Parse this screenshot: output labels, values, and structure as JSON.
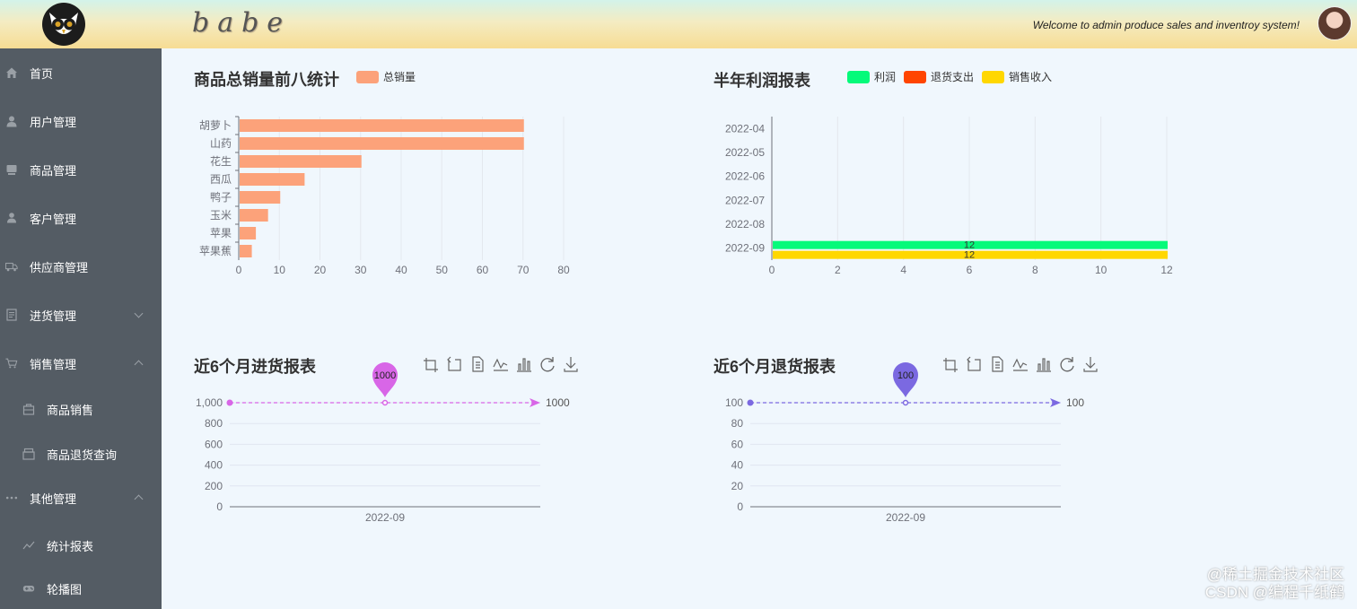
{
  "header": {
    "brand": "babe",
    "welcome": "Welcome to admin produce sales and inventroy system!"
  },
  "sidebar": {
    "items": [
      {
        "label": "首页",
        "icon": "home-icon"
      },
      {
        "label": "用户管理",
        "icon": "user-icon"
      },
      {
        "label": "商品管理",
        "icon": "goods-icon"
      },
      {
        "label": "客户管理",
        "icon": "customer-icon"
      },
      {
        "label": "供应商管理",
        "icon": "truck-icon"
      },
      {
        "label": "进货管理",
        "icon": "document-icon"
      },
      {
        "label": "销售管理",
        "icon": "cart-icon"
      },
      {
        "label": "商品销售",
        "icon": "bag-icon"
      },
      {
        "label": "商品退货查询",
        "icon": "box-icon"
      },
      {
        "label": "其他管理",
        "icon": "more-icon"
      },
      {
        "label": "统计报表",
        "icon": "trend-icon"
      },
      {
        "label": "轮播图",
        "icon": "gamepad-icon"
      }
    ]
  },
  "colors": {
    "sidebar_bg": "#545c64",
    "bar_orange": "#fca27a",
    "profit_green": "#05fa7a",
    "return_red": "#ff4500",
    "sales_yellow": "#ffd700",
    "purchase_purple": "#d866e7",
    "return_purple": "#7b69e1"
  },
  "charts": {
    "top8": {
      "title": "商品总销量前八统计",
      "legend": "总销量"
    },
    "profit": {
      "title": "半年利润报表",
      "legend": [
        "利润",
        "退货支出",
        "销售收入"
      ]
    },
    "purchase": {
      "title": "近6个月进货报表",
      "pin_label": "1000",
      "end_label": "1000"
    },
    "returns": {
      "title": "近6个月退货报表",
      "pin_label": "100",
      "end_label": "100"
    }
  },
  "toolbox_icons": [
    "zoom-icon",
    "zoom-reset-icon",
    "data-view-icon",
    "line-icon",
    "bar-icon",
    "restore-icon",
    "save-icon"
  ],
  "watermark": {
    "line1": "@稀土掘金技术社区",
    "line2": "CSDN @编程千纸鹤"
  },
  "chart_data": [
    {
      "type": "bar",
      "orientation": "horizontal",
      "title": "商品总销量前八统计",
      "categories": [
        "胡萝卜",
        "山药",
        "花生",
        "西瓜",
        "鸭子",
        "玉米",
        "苹果",
        "苹果蕉"
      ],
      "series": [
        {
          "name": "总销量",
          "values": [
            70,
            70,
            30,
            16,
            10,
            7,
            4,
            3
          ]
        }
      ],
      "xlim": [
        0,
        80
      ],
      "xticks": [
        "0",
        "10",
        "20",
        "30",
        "40",
        "50",
        "60",
        "70",
        "80"
      ],
      "grid": true,
      "legend": "top"
    },
    {
      "type": "bar",
      "orientation": "horizontal",
      "title": "半年利润报表",
      "categories": [
        "2022-04",
        "2022-05",
        "2022-06",
        "2022-07",
        "2022-08",
        "2022-09"
      ],
      "series": [
        {
          "name": "利润",
          "values": [
            0,
            0,
            0,
            0,
            0,
            12
          ]
        },
        {
          "name": "退货支出",
          "values": [
            0,
            0,
            0,
            0,
            0,
            0
          ]
        },
        {
          "name": "销售收入",
          "values": [
            0,
            0,
            0,
            0,
            0,
            12
          ]
        }
      ],
      "data_labels": [
        "12",
        "12"
      ],
      "xlim": [
        0,
        12
      ],
      "xticks": [
        "0",
        "2",
        "4",
        "6",
        "8",
        "10",
        "12"
      ],
      "grid": true,
      "legend": "top"
    },
    {
      "type": "line",
      "title": "近6个月进货报表",
      "categories": [
        "2022-09"
      ],
      "series": [
        {
          "values": [
            1000
          ]
        }
      ],
      "ylim": [
        0,
        1000
      ],
      "yticks": [
        "0",
        "200",
        "400",
        "600",
        "800",
        "1,000"
      ],
      "markpoint": "1000",
      "markline": "1000"
    },
    {
      "type": "line",
      "title": "近6个月退货报表",
      "categories": [
        "2022-09"
      ],
      "series": [
        {
          "values": [
            100
          ]
        }
      ],
      "ylim": [
        0,
        100
      ],
      "yticks": [
        "0",
        "20",
        "40",
        "60",
        "80",
        "100"
      ],
      "markpoint": "100",
      "markline": "100"
    }
  ]
}
